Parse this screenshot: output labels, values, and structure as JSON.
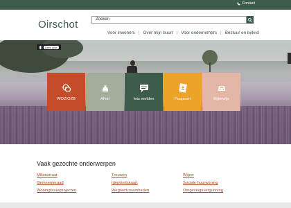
{
  "topbar": {
    "contact_label": "Contact",
    "color": "#3e5c4b"
  },
  "header": {
    "logo": "Oirschot",
    "search": {
      "value": "Zoeken"
    },
    "nav": [
      {
        "label": "Voor inwoners"
      },
      {
        "label": "Over mijn buurt"
      },
      {
        "label": "Voor ondernemers"
      },
      {
        "label": "Bestuur en beleid"
      }
    ]
  },
  "hero": {
    "tag": {
      "text": "Lees voor"
    },
    "tiles": [
      {
        "label": "WOZ/OZB",
        "icon": "coins-icon",
        "color": "#c44c2a"
      },
      {
        "label": "Afval",
        "icon": "trash-bag-icon",
        "color": "#a4ad9c"
      },
      {
        "label": "Iets melden",
        "icon": "speech-bubble-icon",
        "color": "#3e5c4b"
      },
      {
        "label": "Paspoort",
        "icon": "passport-icon",
        "color": "#eda22a"
      },
      {
        "label": "Rijbewijs",
        "icon": "car-icon",
        "color": "#e3b6a8"
      }
    ]
  },
  "popular": {
    "title": "Vaak gezochte onderwerpen",
    "links": [
      "Milieustraat",
      "Trouwen",
      "Wijzer",
      "Gemeenteraad",
      "Identiteitskaart",
      "Sociale huurwoning",
      "Woningbouwprojecten",
      "Wegwerkzaamheden",
      "Omgevingsvergunning"
    ]
  }
}
